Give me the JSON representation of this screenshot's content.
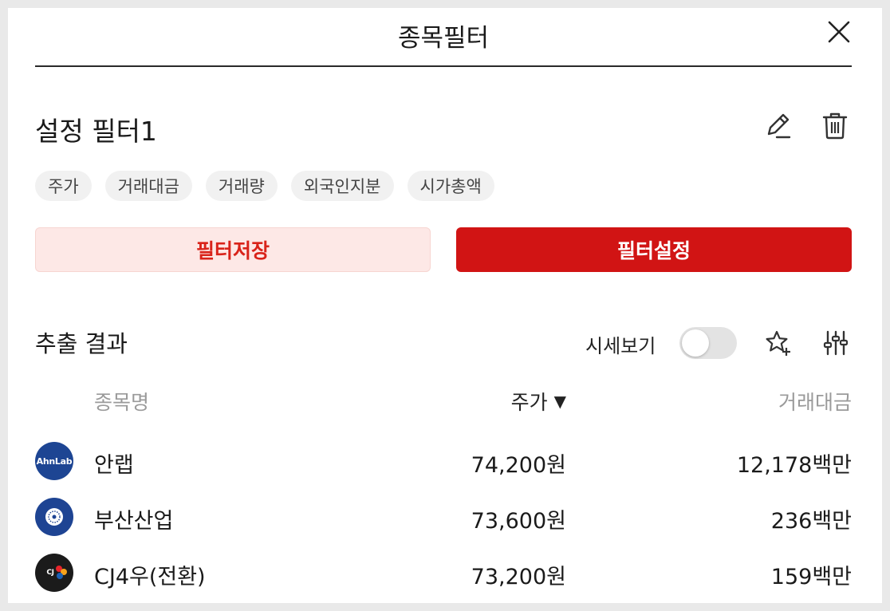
{
  "header": {
    "title": "종목필터"
  },
  "filter": {
    "name": "설정 필터1"
  },
  "tags": [
    "주가",
    "거래대금",
    "거래량",
    "외국인지분",
    "시가총액"
  ],
  "buttons": {
    "save": "필터저장",
    "set": "필터설정"
  },
  "results": {
    "title": "추출 결과",
    "quote_view_label": "시세보기",
    "quote_view_on": false
  },
  "columns": {
    "name": "종목명",
    "price": "주가",
    "price_sort": "▼",
    "amount": "거래대금"
  },
  "rows": [
    {
      "name": "안랩",
      "price": "74,200원",
      "amount": "12,178백만",
      "logo_text": "AhnLab",
      "logo_color": "#1d4593"
    },
    {
      "name": "부산산업",
      "price": "73,600원",
      "amount": "236백만",
      "logo_text": "",
      "logo_color": "#1e4493"
    },
    {
      "name": "CJ4우(전환)",
      "price": "73,200원",
      "amount": "159백만",
      "logo_text": "CJ",
      "logo_color": "#1b1b1b"
    }
  ],
  "colors": {
    "accent": "#d11414",
    "accent_light": "#fde8e6"
  }
}
